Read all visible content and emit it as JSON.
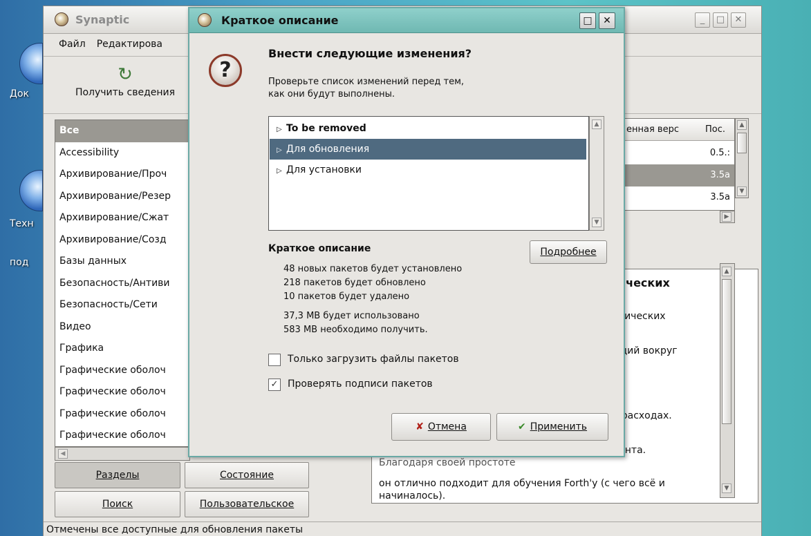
{
  "desktop": {
    "labels": [
      "Док",
      "Техн",
      "под"
    ]
  },
  "main_window": {
    "title": "Synaptic",
    "menu": [
      "Файл",
      "Редактирова"
    ],
    "toolbar": {
      "reload_label": "Получить сведения"
    },
    "sections": [
      "Все",
      "Accessibility",
      "Архивирование/Проч",
      "Архивирование/Резер",
      "Архивирование/Сжат",
      "Архивирование/Созд",
      "Базы данных",
      "Безопасность/Антиви",
      "Безопасность/Сети",
      "Видео",
      "Графика",
      "Графические оболоч",
      "Графические оболоч",
      "Графические оболоч",
      "Графические оболоч"
    ],
    "side_buttons": {
      "sections": "Разделы",
      "status": "Состояние",
      "search": "Поиск",
      "custom": "Пользовательское"
    },
    "package_table": {
      "columns": [
        "енная верс",
        "Пос."
      ],
      "rows": [
        "0.5.:",
        "3.5a",
        "3.5a"
      ]
    },
    "description": {
      "lines": [
        "фических",
        "ифических",
        "нкций вокруг",
        "х расходах.",
        "нента.",
        "Благодаря своей простоте",
        " он отлично подходит для обучения Forth'у (с чего всё и",
        "начиналось)."
      ]
    },
    "status_text": "Отмечены все доступные для обновления пакеты"
  },
  "dialog": {
    "title": "Краткое описание",
    "heading": "Внести следующие изменения?",
    "subtitle_line1": "Проверьте список изменений перед тем,",
    "subtitle_line2": "как они будут выполнены.",
    "tree_items": [
      "To be removed",
      "Для обновления",
      "Для установки"
    ],
    "summary_title": "Краткое описание",
    "details_button": "Подробнее",
    "summary_lines": [
      "48 новых пакетов будет установлено",
      "218 пакетов будет обновлено",
      "10 пакетов будет удалено",
      "37,3 MB будет использовано",
      "583 MB необходимо получить."
    ],
    "checkbox_download_only": "Только загрузить файлы пакетов",
    "checkbox_verify": "Проверять подписи пакетов",
    "cancel_button": "Отмена",
    "apply_button": "Применить"
  }
}
